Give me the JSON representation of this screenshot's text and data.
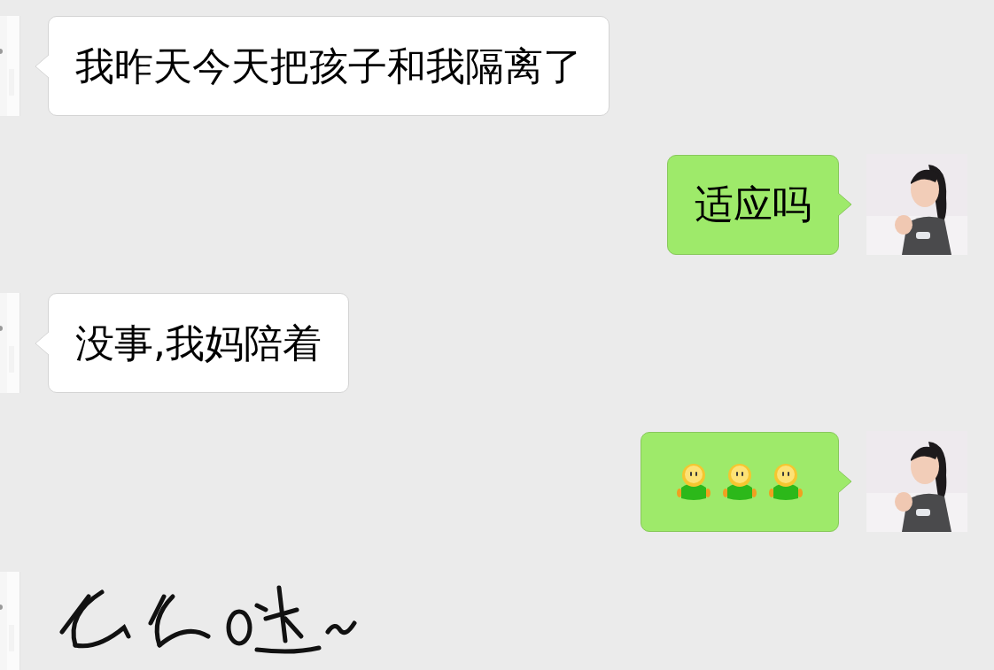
{
  "messages": [
    {
      "outgoing": false,
      "kind": "text",
      "text": "我昨天今天把孩子和我隔离了"
    },
    {
      "outgoing": true,
      "kind": "text",
      "text": "适应吗"
    },
    {
      "outgoing": false,
      "kind": "text",
      "text": "没事,我妈陪着"
    },
    {
      "outgoing": true,
      "kind": "emoji",
      "items": [
        {
          "kind": "figure"
        },
        {
          "kind": "figure"
        },
        {
          "kind": "figure"
        }
      ]
    },
    {
      "outgoing": false,
      "kind": "sticker"
    }
  ]
}
